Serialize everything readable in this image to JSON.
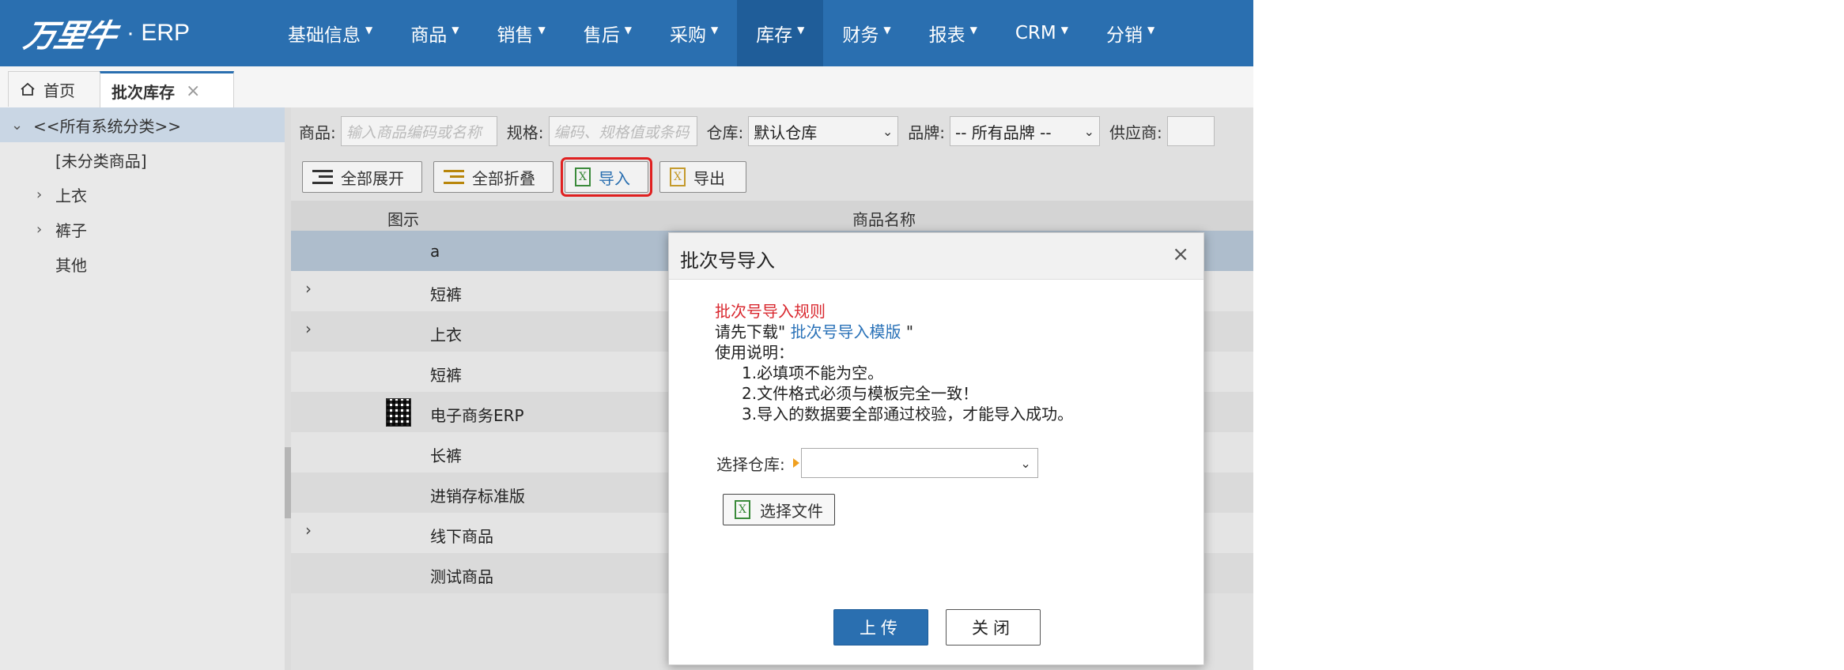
{
  "app": {
    "logo_mark": "万里牛",
    "logo_text": "· ERP"
  },
  "nav": [
    {
      "label": "基础信息"
    },
    {
      "label": "商品"
    },
    {
      "label": "销售"
    },
    {
      "label": "售后"
    },
    {
      "label": "采购"
    },
    {
      "label": "库存"
    },
    {
      "label": "财务"
    },
    {
      "label": "报表"
    },
    {
      "label": "CRM"
    },
    {
      "label": "分销"
    }
  ],
  "colors": {
    "brand": "#2a6fb0",
    "nav_active": "#1f5d99",
    "rule_red": "#d9282f",
    "highlight_red": "#e02020"
  },
  "tabs": {
    "home": "首页",
    "current": "批次库存",
    "close": "×"
  },
  "sidebar": {
    "root": "<<所有系统分类>>",
    "items": [
      "[未分类商品]",
      "上衣",
      "裤子",
      "其他"
    ]
  },
  "filters": {
    "product_label": "商品:",
    "product_placeholder": "输入商品编码或名称",
    "spec_label": "规格:",
    "spec_placeholder": "编码、规格值或条码",
    "warehouse_label": "仓库:",
    "warehouse_value": "默认仓库",
    "brand_label": "品牌:",
    "brand_value": "-- 所有品牌 --",
    "supplier_label": "供应商:"
  },
  "toolbar": {
    "expand_all": "全部展开",
    "collapse_all": "全部折叠",
    "import": "导入",
    "export": "导出"
  },
  "grid": {
    "col_image": "图示",
    "col_name": "商品名称",
    "rows": [
      "a",
      "短裤",
      "上衣",
      "短裤",
      "电子商务ERP",
      "长裤",
      "进销存标准版",
      "线下商品",
      "测试商品"
    ]
  },
  "modal": {
    "title": "批次号导入",
    "close": "×",
    "rule_title": "批次号导入规则",
    "download_prefix": "请先下载\"",
    "template_link": "批次号导入模版",
    "download_suffix": "\"",
    "usage_label": "使用说明：",
    "rules": [
      "1.必填项不能为空。",
      "2.文件格式必须与模板完全一致！",
      "3.导入的数据要全部通过校验，才能导入成功。"
    ],
    "warehouse_label": "选择仓库:",
    "choose_file": "选择文件",
    "upload": "上传",
    "close_btn": "关闭"
  }
}
